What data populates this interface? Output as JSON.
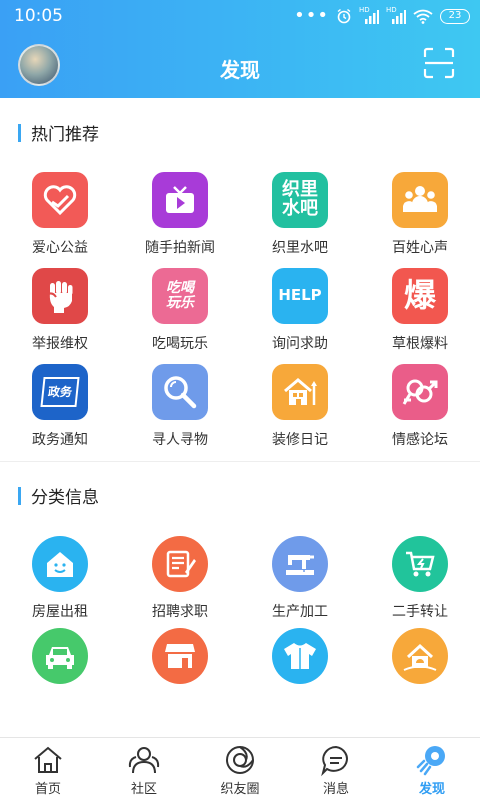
{
  "status": {
    "time": "10:05",
    "battery": "23",
    "hd1": "HD",
    "hd2": "HD"
  },
  "header": {
    "title": "发现"
  },
  "hot": {
    "title": "热门推荐",
    "items": [
      {
        "label": "爱心公益",
        "color": "#f25a57",
        "icon": "heart-hand-icon"
      },
      {
        "label": "随手拍新闻",
        "color": "#a83bd8",
        "icon": "tv-play-icon"
      },
      {
        "label": "织里水吧",
        "color": "#22c0a0",
        "icon": "water-bar-text-icon",
        "icon_text": "织里\n水吧"
      },
      {
        "label": "百姓心声",
        "color": "#f7a83a",
        "icon": "people-group-icon"
      },
      {
        "label": "举报维权",
        "color": "#e04848",
        "icon": "raised-fist-icon"
      },
      {
        "label": "吃喝玩乐",
        "color": "#ec6a94",
        "icon": "eat-drink-text-icon",
        "icon_text": "吃喝\n玩乐"
      },
      {
        "label": "询问求助",
        "color": "#2ab3f0",
        "icon": "help-text-icon",
        "icon_text": "HELP"
      },
      {
        "label": "草根爆料",
        "color": "#f2574f",
        "icon": "explode-text-icon",
        "icon_text": "爆"
      },
      {
        "label": "政务通知",
        "color": "#1d64c9",
        "icon": "government-notice-icon",
        "icon_text": "政务"
      },
      {
        "label": "寻人寻物",
        "color": "#6f9bea",
        "icon": "magnifier-icon"
      },
      {
        "label": "装修日记",
        "color": "#f7a83a",
        "icon": "house-renovation-icon"
      },
      {
        "label": "情感论坛",
        "color": "#ea5d89",
        "icon": "gender-symbol-icon"
      }
    ]
  },
  "category": {
    "title": "分类信息",
    "items": [
      {
        "label": "房屋出租",
        "color": "#2ab3f0",
        "icon": "house-smile-icon"
      },
      {
        "label": "招聘求职",
        "color": "#f36b44",
        "icon": "resume-pen-icon"
      },
      {
        "label": "生产加工",
        "color": "#6f9bea",
        "icon": "sewing-machine-icon"
      },
      {
        "label": "二手转让",
        "color": "#21c49b",
        "icon": "shopping-cart-icon"
      },
      {
        "label": "",
        "color": "#46c96b",
        "icon": "car-icon"
      },
      {
        "label": "",
        "color": "#f36b44",
        "icon": "storefront-icon"
      },
      {
        "label": "",
        "color": "#2ab3f0",
        "icon": "clothing-icon"
      },
      {
        "label": "",
        "color": "#f7a83a",
        "icon": "house-location-icon"
      }
    ]
  },
  "tabbar": {
    "tabs": [
      {
        "label": "首页",
        "icon": "home-icon"
      },
      {
        "label": "社区",
        "icon": "community-icon"
      },
      {
        "label": "织友圈",
        "icon": "friend-circle-icon"
      },
      {
        "label": "消息",
        "icon": "message-icon"
      },
      {
        "label": "发现",
        "icon": "discover-rocket-icon",
        "active": true
      }
    ],
    "active_color": "#2f9df3"
  }
}
